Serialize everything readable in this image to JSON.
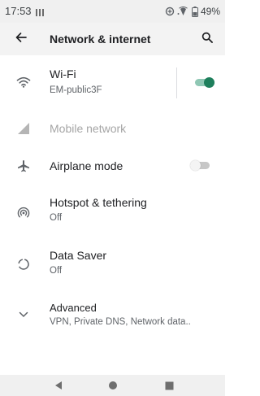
{
  "status_bar": {
    "time": "17:53",
    "battery_percent": "49%",
    "icons": [
      "notification-icon",
      "data-saver-icon",
      "wifi-signal-icon",
      "battery-icon"
    ]
  },
  "header": {
    "title": "Network & internet",
    "back_icon": "back-arrow-icon",
    "search_icon": "search-icon"
  },
  "items": [
    {
      "title": "Wi-Fi",
      "subtitle": "EM-public3F",
      "icon": "wifi-icon",
      "toggle": true
    },
    {
      "title": "Mobile network",
      "subtitle": "",
      "icon": "cellular-signal-icon",
      "disabled": true
    },
    {
      "title": "Airplane mode",
      "subtitle": "",
      "icon": "airplane-icon",
      "toggle": false
    },
    {
      "title": "Hotspot & tethering",
      "subtitle": "Off",
      "icon": "hotspot-icon"
    },
    {
      "title": "Data Saver",
      "subtitle": "Off",
      "icon": "data-saver-icon"
    },
    {
      "title": "Advanced",
      "subtitle": "VPN, Private DNS, Network data..",
      "icon": "chevron-down-icon"
    }
  ],
  "nav_bar": {
    "buttons": [
      "back-triangle-icon",
      "home-circle-icon",
      "recents-square-icon"
    ]
  },
  "colors": {
    "accent": "#1e7f5c",
    "accent_track": "#8fc7b4",
    "status_bar_bg": "#f0f0f0",
    "app_bar_bg": "#f3f3f3"
  }
}
